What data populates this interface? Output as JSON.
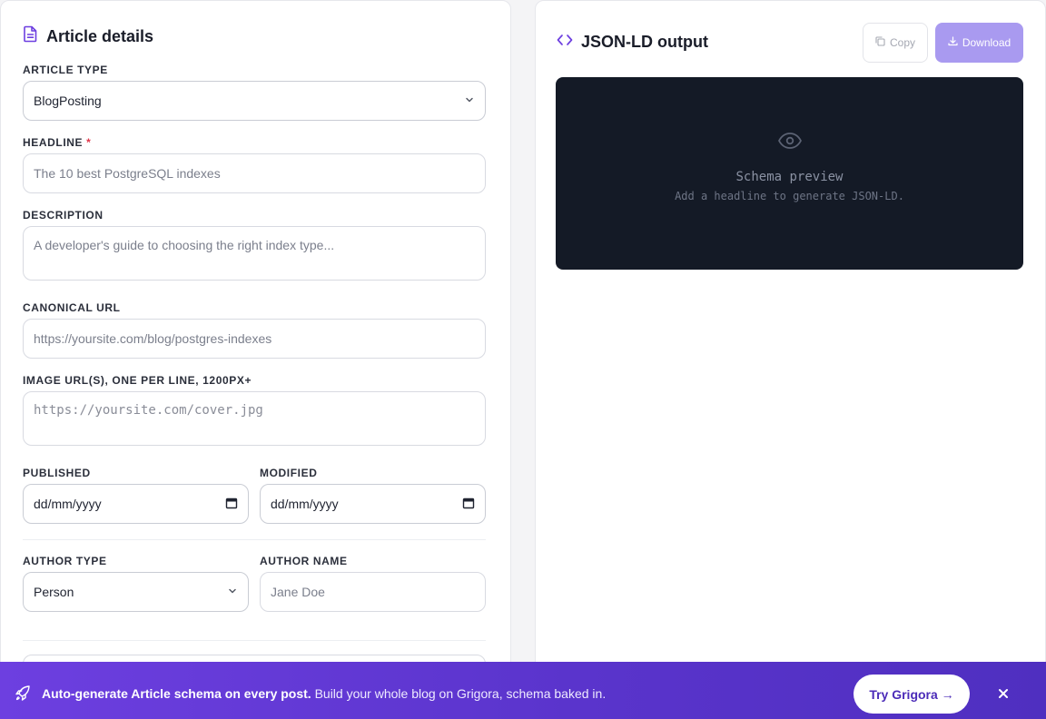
{
  "left_panel": {
    "title": "Article details",
    "fields": {
      "article_type": {
        "label": "ARTICLE TYPE",
        "value": "BlogPosting"
      },
      "headline": {
        "label": "HEADLINE",
        "required_mark": "*",
        "placeholder": "The 10 best PostgreSQL indexes"
      },
      "description": {
        "label": "DESCRIPTION",
        "placeholder": "A developer's guide to choosing the right index type..."
      },
      "canonical_url": {
        "label": "CANONICAL URL",
        "placeholder": "https://yoursite.com/blog/postgres-indexes"
      },
      "image_urls": {
        "label": "IMAGE URL(S), ONE PER LINE, 1200PX+",
        "placeholder": "https://yoursite.com/cover.jpg"
      },
      "published": {
        "label": "PUBLISHED",
        "value": "dd/mm/yyyy"
      },
      "modified": {
        "label": "MODIFIED",
        "value": "dd/mm/yyyy"
      },
      "author_type": {
        "label": "AUTHOR TYPE",
        "value": "Person"
      },
      "author_name": {
        "label": "AUTHOR NAME",
        "placeholder": "Jane Doe"
      }
    }
  },
  "right_panel": {
    "title": "JSON-LD output",
    "copy_label": "Copy",
    "download_label": "Download",
    "preview": {
      "title": "Schema preview",
      "subtitle": "Add a headline to generate JSON-LD."
    }
  },
  "banner": {
    "bold_text": "Auto-generate Article schema on every post.",
    "text": " Build your whole blog on Grigora, schema baked in.",
    "cta_label": "Try Grigora →"
  },
  "colors": {
    "accent": "#6d3fe0",
    "download_button": "#a99af0",
    "preview_bg": "#141a26",
    "required": "#e0364a"
  }
}
